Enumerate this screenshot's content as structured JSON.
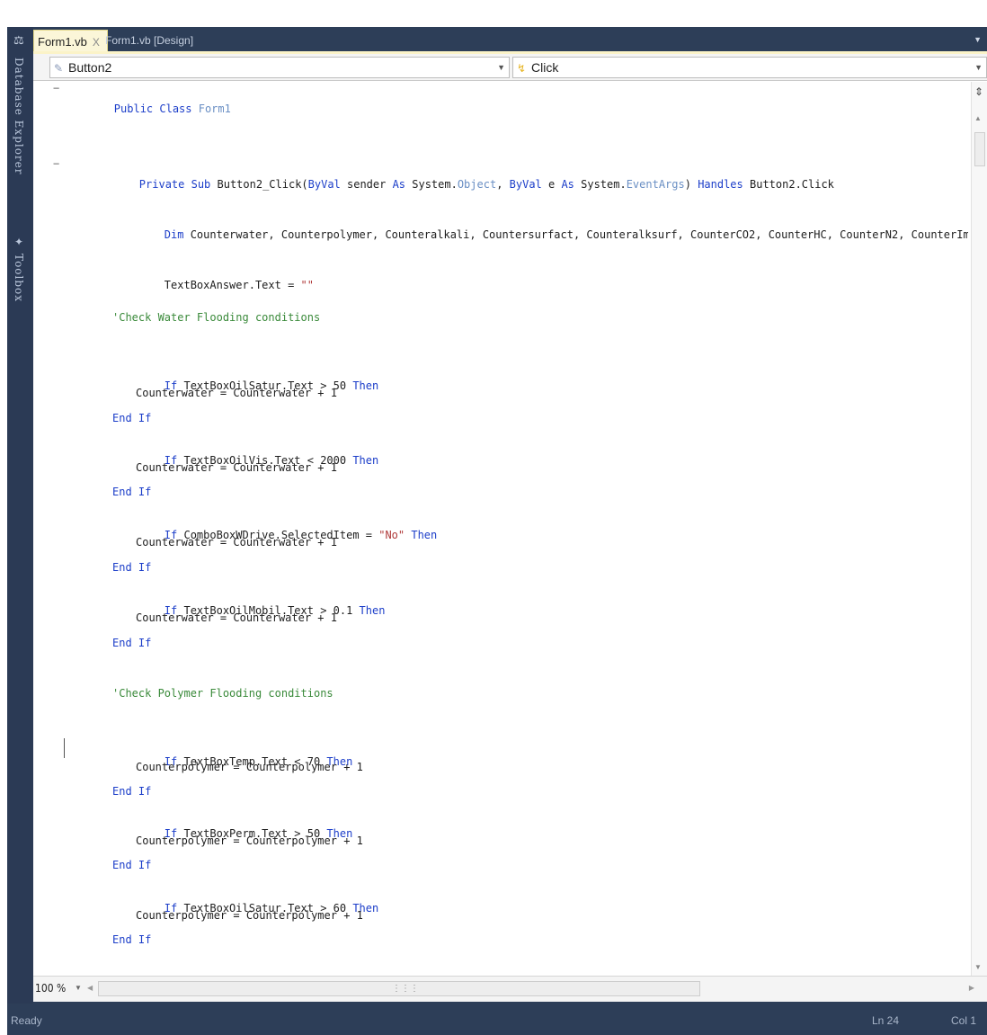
{
  "tabs": [
    {
      "label": "Form1.vb",
      "close": "X",
      "active": true
    },
    {
      "label": "Form1.vb [Design]",
      "active": false
    }
  ],
  "side_tabs": [
    "Database Explorer",
    "Toolbox"
  ],
  "nav": {
    "object": "Button2",
    "event": "Click"
  },
  "code": {
    "class_header": {
      "kw": "Public Class ",
      "name": "Form1"
    },
    "sub": {
      "kw1": "Private Sub ",
      "name": "Button2_Click(",
      "kw2": "ByVal",
      "p1": " sender ",
      "kw3": "As",
      "p2": " System.",
      "t1": "Object",
      "p3": ", ",
      "kw4": "ByVal",
      "p4": " e ",
      "kw5": "As",
      "p5": " System.",
      "t2": "EventArgs",
      "p6": ") ",
      "kw6": "Handles",
      "p7": " Button2.Click"
    },
    "dim": {
      "kw": "Dim",
      "rest": " Counterwater, Counterpolymer, Counteralkali, Countersurfact, Counteralksurf, CounterCO2, CounterHC, CounterN2, CounterImmi, Countersteam, Co"
    },
    "answer": {
      "text": "TextBoxAnswer.Text = ",
      "str": "\"\""
    },
    "comment_water": "'Check Water Flooding conditions",
    "comment_polymer": "'Check Polymer Flooding conditions",
    "water_rules": [
      {
        "kw": "If",
        "cond": " TextBoxOilSatur.Text > 50 ",
        "str": "",
        "tail": "",
        "then": "Then",
        "body": "Counterwater = Counterwater + 1",
        "end": "End If"
      },
      {
        "kw": "If",
        "cond": " TextBoxOilVis.Text < 2000 ",
        "str": "",
        "tail": "",
        "then": "Then",
        "body": "Counterwater = Counterwater + 1",
        "end": "End If"
      },
      {
        "kw": "If",
        "cond": " ComboBoxWDrive.SelectedItem = ",
        "str": "\"No\"",
        "tail": " ",
        "then": "Then",
        "body": "Counterwater = Counterwater + 1",
        "end": "End If"
      },
      {
        "kw": "If",
        "cond": " TextBoxOilMobil.Text > 0.1 ",
        "str": "",
        "tail": "",
        "then": "Then",
        "body": "Counterwater = Counterwater + 1",
        "end": "End If"
      }
    ],
    "polymer_rules": [
      {
        "kw": "If",
        "cond": " TextBoxTemp.Text < 70 ",
        "then": "Then",
        "body": "Counterpolymer = Counterpolymer + 1",
        "end": "End If"
      },
      {
        "kw": "If",
        "cond": " TextBoxPerm.Text > 50 ",
        "then": "Then",
        "body": "Counterpolymer = Counterpolymer + 1",
        "end": "End If"
      },
      {
        "kw": "If",
        "cond": " TextBoxOilSatur.Text > 60 ",
        "then": "Then",
        "body": "Counterpolymer = Counterpolymer + 1",
        "end": "End If"
      }
    ]
  },
  "zoom": "100 %",
  "status": {
    "ready": "Ready",
    "ln": "Ln 24",
    "col": "Col 1"
  },
  "colors": {
    "chrome": "#2d3e58",
    "active_tab": "#fbf6d8",
    "keyword": "#1c3ec9",
    "type": "#6a8fc4",
    "comment": "#3a8a3a",
    "string": "#b03a3a"
  }
}
